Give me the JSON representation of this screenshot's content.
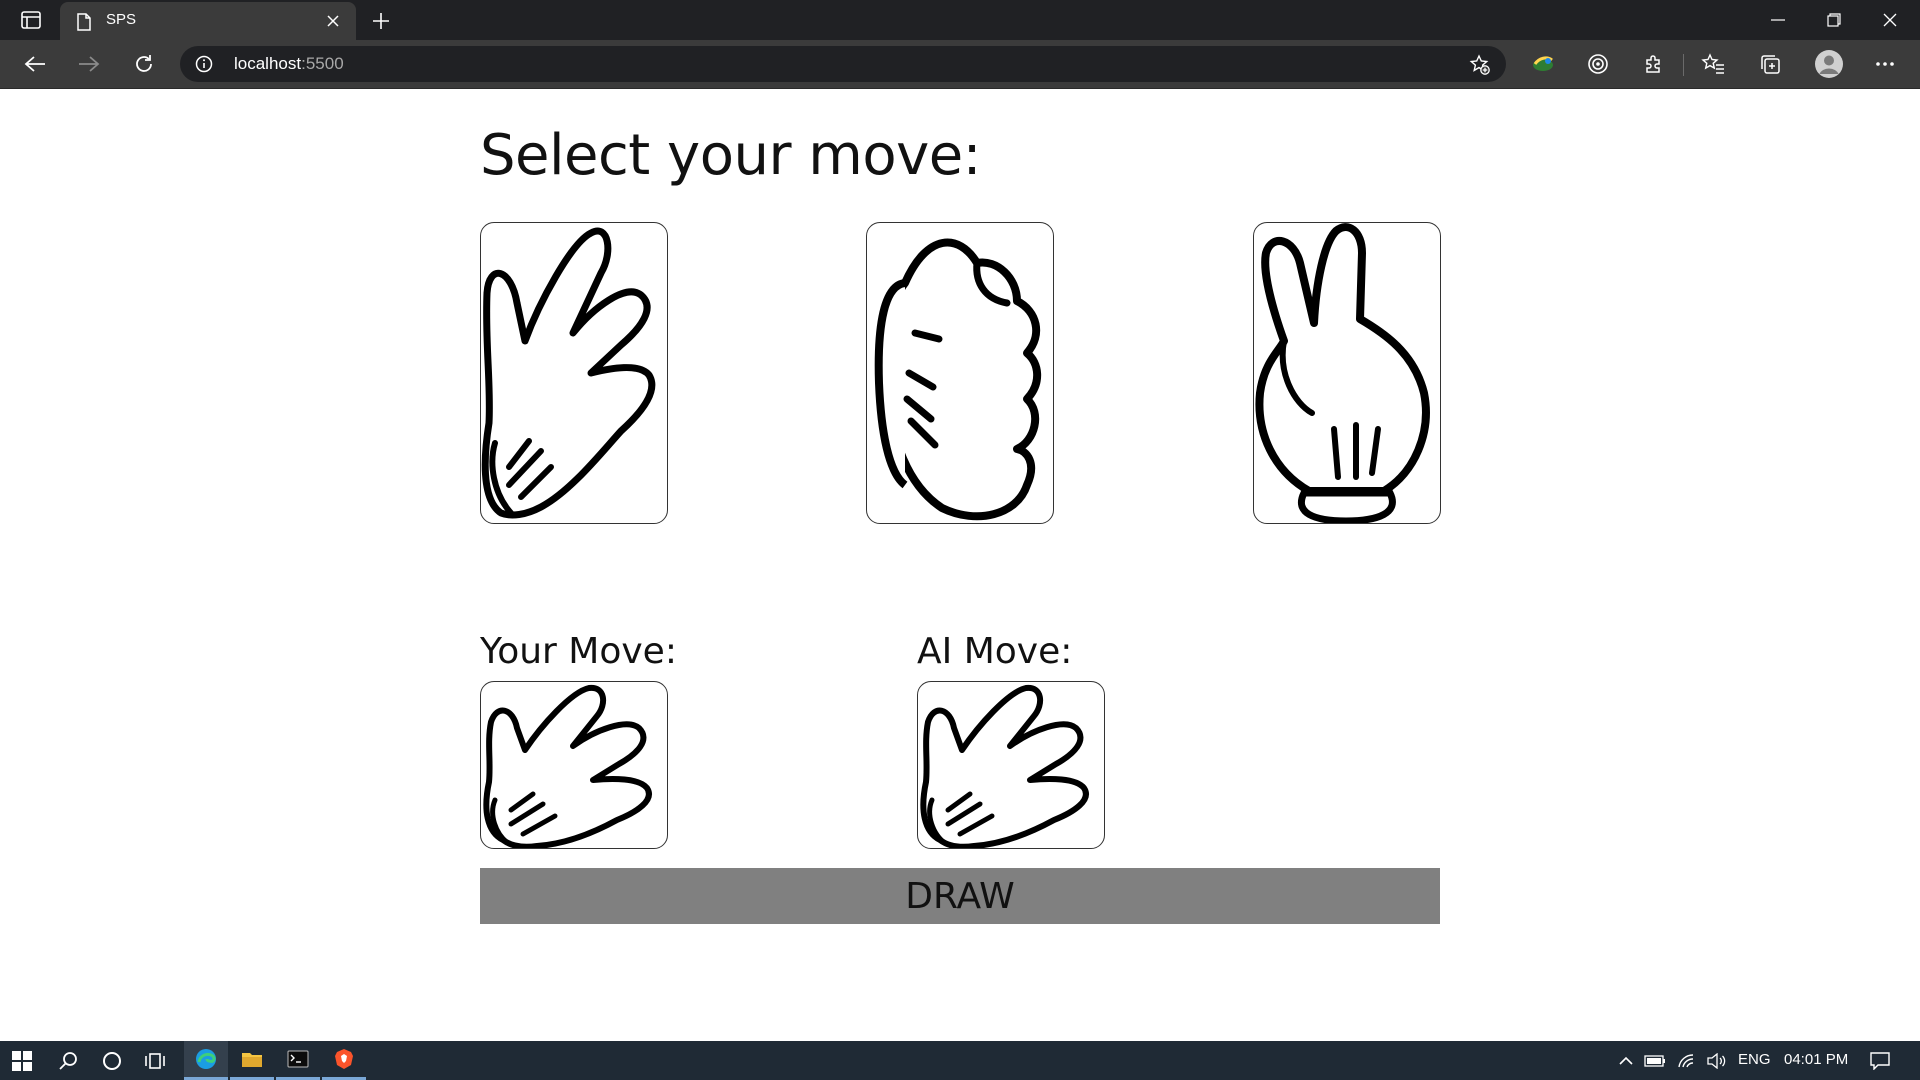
{
  "browser": {
    "tab_title": "SPS",
    "url_host": "localhost",
    "url_port": ":5500"
  },
  "page": {
    "heading": "Select your move:",
    "choices": [
      {
        "name": "paper",
        "icon": "paper-hand-icon"
      },
      {
        "name": "rock",
        "icon": "rock-fist-icon"
      },
      {
        "name": "scissors",
        "icon": "scissors-hand-icon"
      }
    ],
    "your_move_label": "Your Move:",
    "your_move_icon": "paper-hand-icon",
    "ai_move_label": "AI Move:",
    "ai_move_icon": "paper-hand-icon",
    "result_text": "DRAW",
    "result_bg": "#808080"
  },
  "taskbar": {
    "language": "ENG",
    "time": "04:01 PM"
  }
}
